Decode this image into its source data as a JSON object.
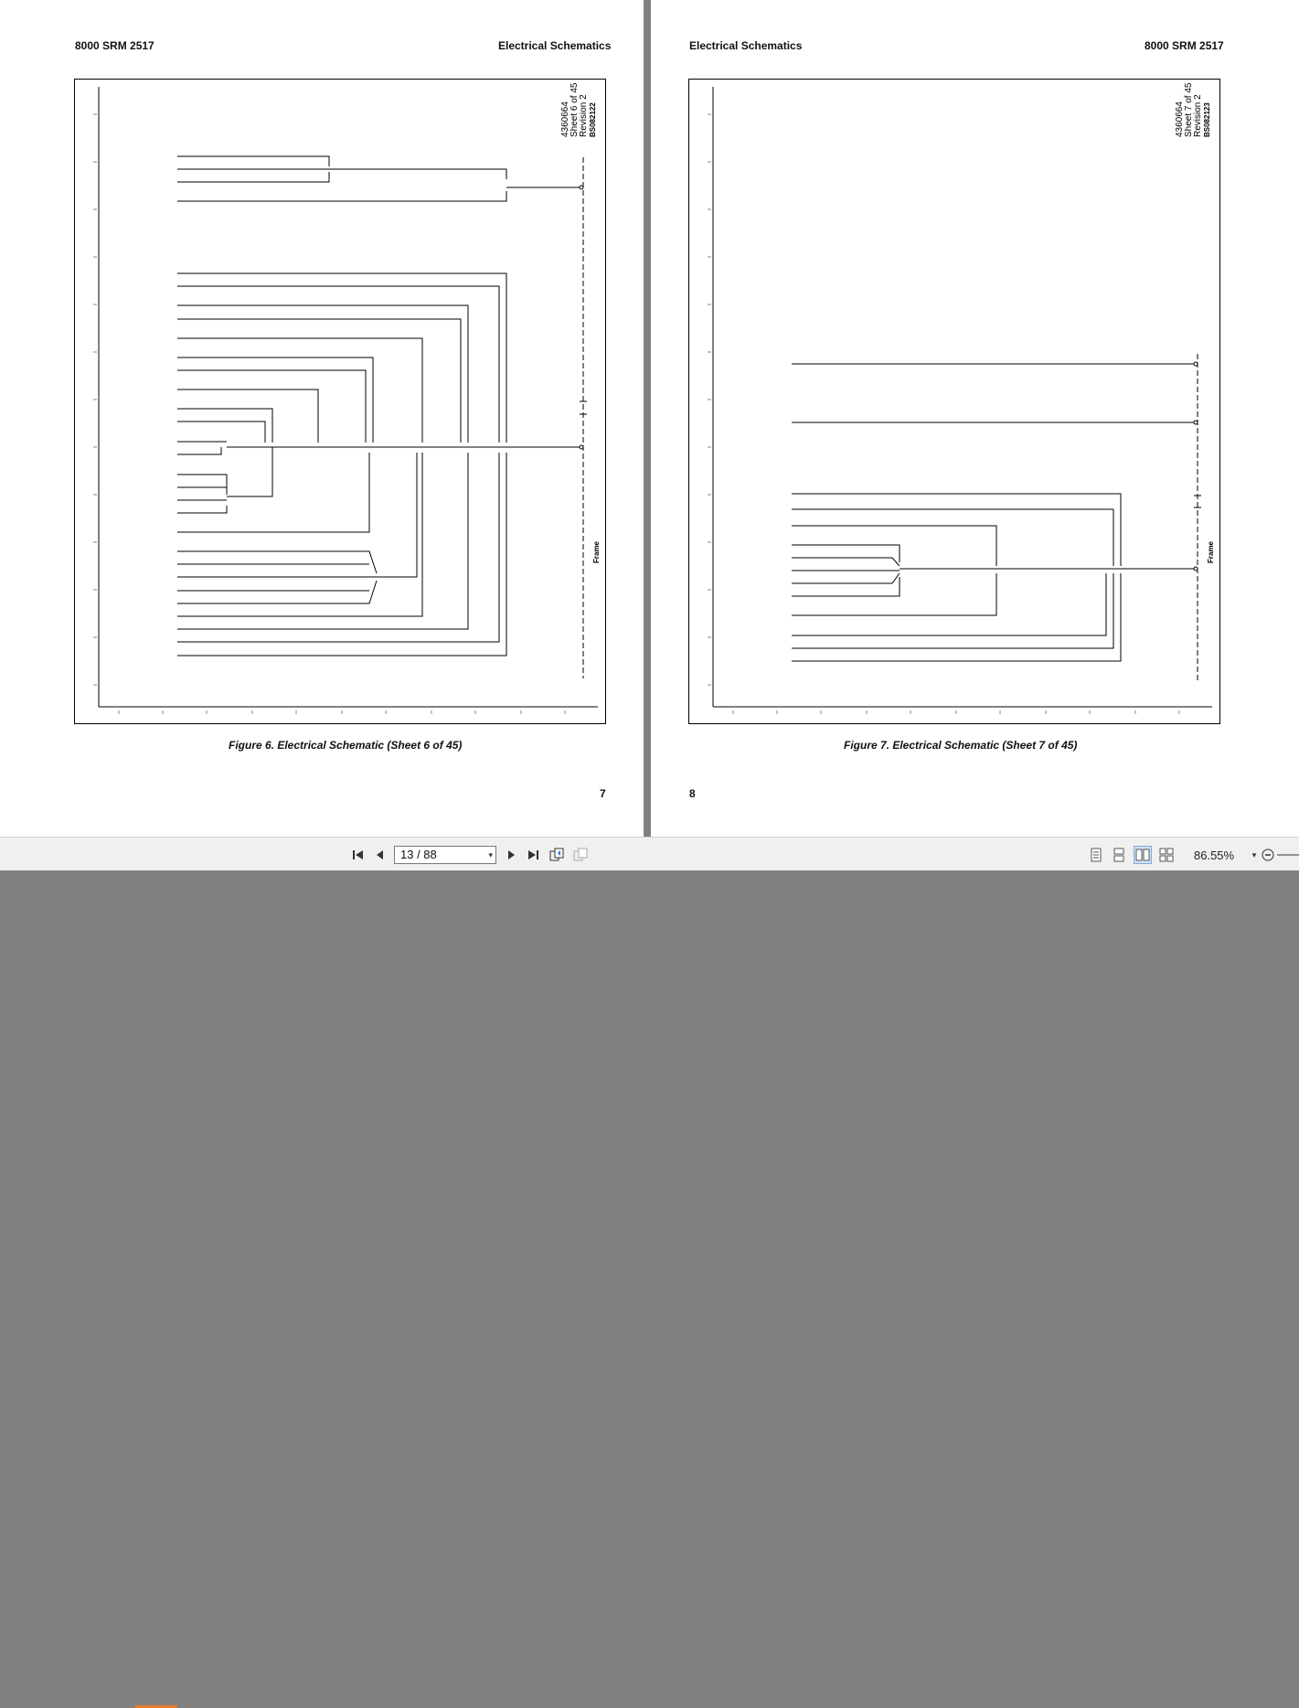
{
  "viewer": {
    "page_field": "13 / 88",
    "zoom": "86.55%"
  },
  "left_page": {
    "header_left": "8000 SRM 2517",
    "header_right": "Electrical Schematics",
    "caption": "Figure 6. Electrical Schematic (Sheet 6 of 45)",
    "page_number": "7",
    "sheet_info": [
      "4360664",
      "Sheet 6 of 45",
      "Revision 2"
    ],
    "doc_id": "BS082122",
    "frame_tag": "Frame"
  },
  "right_page": {
    "header_left": "Electrical Schematics",
    "header_right": "8000 SRM 2517",
    "caption": "Figure 7. Electrical Schematic (Sheet 7 of 45)",
    "page_number": "8",
    "sheet_info": [
      "4360664",
      "Sheet 7 of 45",
      "Revision 2"
    ],
    "doc_id": "BS082123",
    "frame_tag": "Frame"
  }
}
